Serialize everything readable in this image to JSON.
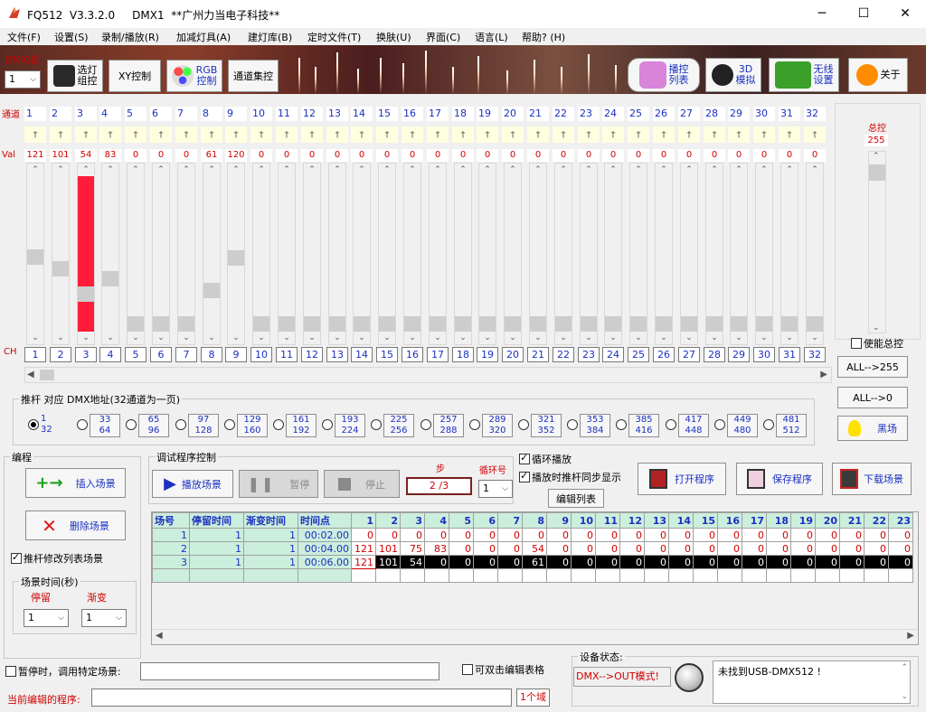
{
  "window": {
    "title": "FQ512  V3.3.2.0     DMX1  **广州力当电子科技**",
    "minimize": "─",
    "maximize": "☐",
    "close": "✕"
  },
  "menu": [
    "文件(F)",
    "设置(S)",
    "录制/播放(R)",
    "加减灯具(A)",
    "建灯库(B)",
    "定时文件(T)",
    "换肤(U)",
    "界面(C)",
    "语言(L)",
    "帮助? (H)"
  ],
  "toolbar": {
    "dmx_domain_label": "DMX域",
    "dmx_domain_value": "1",
    "btn_select_lamp": "选灯\n组控",
    "btn_xy": "XY控制",
    "btn_rgb": "RGB\n控制",
    "btn_channel_group": "通道集控",
    "btn_playlist": "播控\n列表",
    "btn_3d": "3D\n模拟",
    "btn_wireless": "无线\n设置",
    "btn_about": "关于"
  },
  "channels": {
    "row_label_top": "通道",
    "row_label_val": "Val",
    "row_label_ch": "CH",
    "numbers": [
      "1",
      "2",
      "3",
      "4",
      "5",
      "6",
      "7",
      "8",
      "9",
      "10",
      "11",
      "12",
      "13",
      "14",
      "15",
      "16",
      "17",
      "18",
      "19",
      "20",
      "21",
      "22",
      "23",
      "24",
      "25",
      "26",
      "27",
      "28",
      "29",
      "30",
      "31",
      "32"
    ],
    "values": [
      "121",
      "101",
      "54",
      "83",
      "0",
      "0",
      "0",
      "61",
      "120",
      "0",
      "0",
      "0",
      "0",
      "0",
      "0",
      "0",
      "0",
      "0",
      "0",
      "0",
      "0",
      "0",
      "0",
      "0",
      "0",
      "0",
      "0",
      "0",
      "0",
      "0",
      "0",
      "0"
    ],
    "levels": [
      121,
      101,
      54,
      83,
      0,
      0,
      0,
      61,
      120,
      0,
      0,
      0,
      0,
      0,
      0,
      0,
      0,
      0,
      0,
      0,
      0,
      0,
      0,
      0,
      0,
      0,
      0,
      0,
      0,
      0,
      0,
      0
    ],
    "highlight_channel": 3,
    "highlight_color": "#ff1b3a"
  },
  "master": {
    "label": "总控",
    "value": "255",
    "enable_label": "使能总控",
    "all_255": "ALL-->255",
    "all_0": "ALL-->0",
    "blackout": "黑场"
  },
  "fader_group": {
    "title": "推杆 对应 DMX地址(32通道为一页)",
    "pages": [
      {
        "a": "1",
        "b": "32",
        "selected": true
      },
      {
        "a": "33",
        "b": "64"
      },
      {
        "a": "65",
        "b": "96"
      },
      {
        "a": "97",
        "b": "128"
      },
      {
        "a": "129",
        "b": "160"
      },
      {
        "a": "161",
        "b": "192"
      },
      {
        "a": "193",
        "b": "224"
      },
      {
        "a": "225",
        "b": "256"
      },
      {
        "a": "257",
        "b": "288"
      },
      {
        "a": "289",
        "b": "320"
      },
      {
        "a": "321",
        "b": "352"
      },
      {
        "a": "353",
        "b": "384"
      },
      {
        "a": "385",
        "b": "416"
      },
      {
        "a": "417",
        "b": "448"
      },
      {
        "a": "449",
        "b": "480"
      },
      {
        "a": "481",
        "b": "512"
      }
    ]
  },
  "edit": {
    "title": "编程",
    "insert_scene": "插入场景",
    "delete_scene": "删除场景",
    "fader_modify": "推杆修改列表场景",
    "scene_time_title": "场景时间(秒)",
    "stay_label": "停留",
    "fade_label": "渐变",
    "stay_value": "1",
    "fade_value": "1"
  },
  "debug": {
    "title": "调试程序控制",
    "play": "播放场景",
    "pause": "暂停",
    "stop": "停止",
    "step_label": "步",
    "step_value": "2 /3",
    "loop_label": "循环号",
    "loop_value": "1",
    "loop_play": "循环播放",
    "sync_display": "播放时推杆同步显示",
    "edit_list": "编辑列表",
    "open_program": "打开程序",
    "save_program": "保存程序",
    "download_scene": "下载场景"
  },
  "table": {
    "headers": [
      "场号",
      "停留时间",
      "渐变时间",
      "时间点",
      "1",
      "2",
      "3",
      "4",
      "5",
      "6",
      "7",
      "8",
      "9",
      "10",
      "11",
      "12",
      "13",
      "14",
      "15",
      "16",
      "17",
      "18",
      "19",
      "20",
      "21",
      "22",
      "23"
    ],
    "rows": [
      [
        "1",
        "1",
        "1",
        "00:02.00",
        "0",
        "0",
        "0",
        "0",
        "0",
        "0",
        "0",
        "0",
        "0",
        "0",
        "0",
        "0",
        "0",
        "0",
        "0",
        "0",
        "0",
        "0",
        "0",
        "0",
        "0",
        "0",
        "0"
      ],
      [
        "2",
        "1",
        "1",
        "00:04.00",
        "121",
        "101",
        "75",
        "83",
        "0",
        "0",
        "0",
        "54",
        "0",
        "0",
        "0",
        "0",
        "0",
        "0",
        "0",
        "0",
        "0",
        "0",
        "0",
        "0",
        "0",
        "0",
        "0"
      ],
      [
        "3",
        "1",
        "1",
        "00:06.00",
        "121",
        "101",
        "54",
        "0",
        "0",
        "0",
        "0",
        "61",
        "0",
        "0",
        "0",
        "0",
        "0",
        "0",
        "0",
        "0",
        "0",
        "0",
        "0",
        "0",
        "0",
        "0",
        "0"
      ]
    ]
  },
  "bottom": {
    "pause_call_label": "暂停时，调用特定场景:",
    "double_click_edit": "可双击编辑表格",
    "current_program_label": "当前编辑的程序:",
    "domain_count": "1个域",
    "device_status_title": "设备状态:",
    "dmx_out_mode": "DMX-->OUT模式!",
    "status_message": "未找到USB-DMX512 !"
  }
}
